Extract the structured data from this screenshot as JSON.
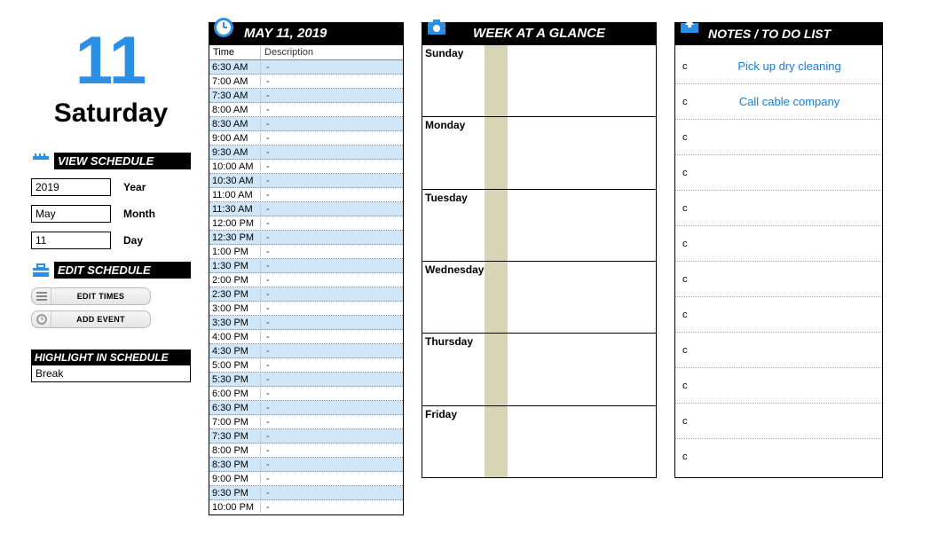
{
  "date": {
    "big_number": "11",
    "big_day": "Saturday"
  },
  "left": {
    "view_title": "VIEW SCHEDULE",
    "year_value": "2019",
    "year_label": "Year",
    "month_value": "May",
    "month_label": "Month",
    "day_value": "11",
    "day_label": "Day",
    "edit_title": "EDIT SCHEDULE",
    "btn_edit_times": "EDIT TIMES",
    "btn_add_event": "ADD  EVENT",
    "highlight_title": "HIGHLIGHT IN SCHEDULE",
    "highlight_value": "Break"
  },
  "schedule": {
    "title": "MAY 11,  2019",
    "hdr_time": "Time",
    "hdr_desc": "Description",
    "rows": [
      {
        "t": "6:30 AM",
        "d": "-",
        "a": 1
      },
      {
        "t": "7:00 AM",
        "d": "-",
        "a": 0
      },
      {
        "t": "7:30 AM",
        "d": "-",
        "a": 1
      },
      {
        "t": "8:00 AM",
        "d": "-",
        "a": 0
      },
      {
        "t": "8:30 AM",
        "d": "-",
        "a": 1
      },
      {
        "t": "9:00 AM",
        "d": "-",
        "a": 0
      },
      {
        "t": "9:30 AM",
        "d": "-",
        "a": 1
      },
      {
        "t": "10:00 AM",
        "d": "-",
        "a": 0
      },
      {
        "t": "10:30 AM",
        "d": "-",
        "a": 1
      },
      {
        "t": "11:00 AM",
        "d": "-",
        "a": 0
      },
      {
        "t": "11:30 AM",
        "d": "-",
        "a": 1
      },
      {
        "t": "12:00 PM",
        "d": "-",
        "a": 0
      },
      {
        "t": "12:30 PM",
        "d": "-",
        "a": 1
      },
      {
        "t": "1:00 PM",
        "d": "-",
        "a": 0
      },
      {
        "t": "1:30 PM",
        "d": "-",
        "a": 1
      },
      {
        "t": "2:00 PM",
        "d": "-",
        "a": 0
      },
      {
        "t": "2:30 PM",
        "d": "-",
        "a": 1
      },
      {
        "t": "3:00 PM",
        "d": "-",
        "a": 0
      },
      {
        "t": "3:30 PM",
        "d": "-",
        "a": 1
      },
      {
        "t": "4:00 PM",
        "d": "-",
        "a": 0
      },
      {
        "t": "4:30 PM",
        "d": "-",
        "a": 1
      },
      {
        "t": "5:00 PM",
        "d": "-",
        "a": 0
      },
      {
        "t": "5:30 PM",
        "d": "-",
        "a": 1
      },
      {
        "t": "6:00 PM",
        "d": "-",
        "a": 0
      },
      {
        "t": "6:30 PM",
        "d": "-",
        "a": 1
      },
      {
        "t": "7:00 PM",
        "d": "-",
        "a": 0
      },
      {
        "t": "7:30 PM",
        "d": "-",
        "a": 1
      },
      {
        "t": "8:00 PM",
        "d": "-",
        "a": 0
      },
      {
        "t": "8:30 PM",
        "d": "-",
        "a": 1
      },
      {
        "t": "9:00 PM",
        "d": "-",
        "a": 0
      },
      {
        "t": "9:30 PM",
        "d": "-",
        "a": 1
      },
      {
        "t": "10:00 PM",
        "d": "-",
        "a": 0
      }
    ]
  },
  "week": {
    "title": "WEEK AT A GLANCE",
    "days": [
      "Sunday",
      "Monday",
      "Tuesday",
      "Wednesday",
      "Thursday",
      "Friday"
    ]
  },
  "notes": {
    "title": "NOTES / TO DO LIST",
    "bullet": "c",
    "items": [
      {
        "text": "Pick up dry cleaning"
      },
      {
        "text": "Call cable company"
      },
      {
        "text": ""
      },
      {
        "text": ""
      },
      {
        "text": ""
      },
      {
        "text": ""
      },
      {
        "text": ""
      },
      {
        "text": ""
      },
      {
        "text": ""
      },
      {
        "text": ""
      },
      {
        "text": ""
      },
      {
        "text": ""
      }
    ]
  }
}
